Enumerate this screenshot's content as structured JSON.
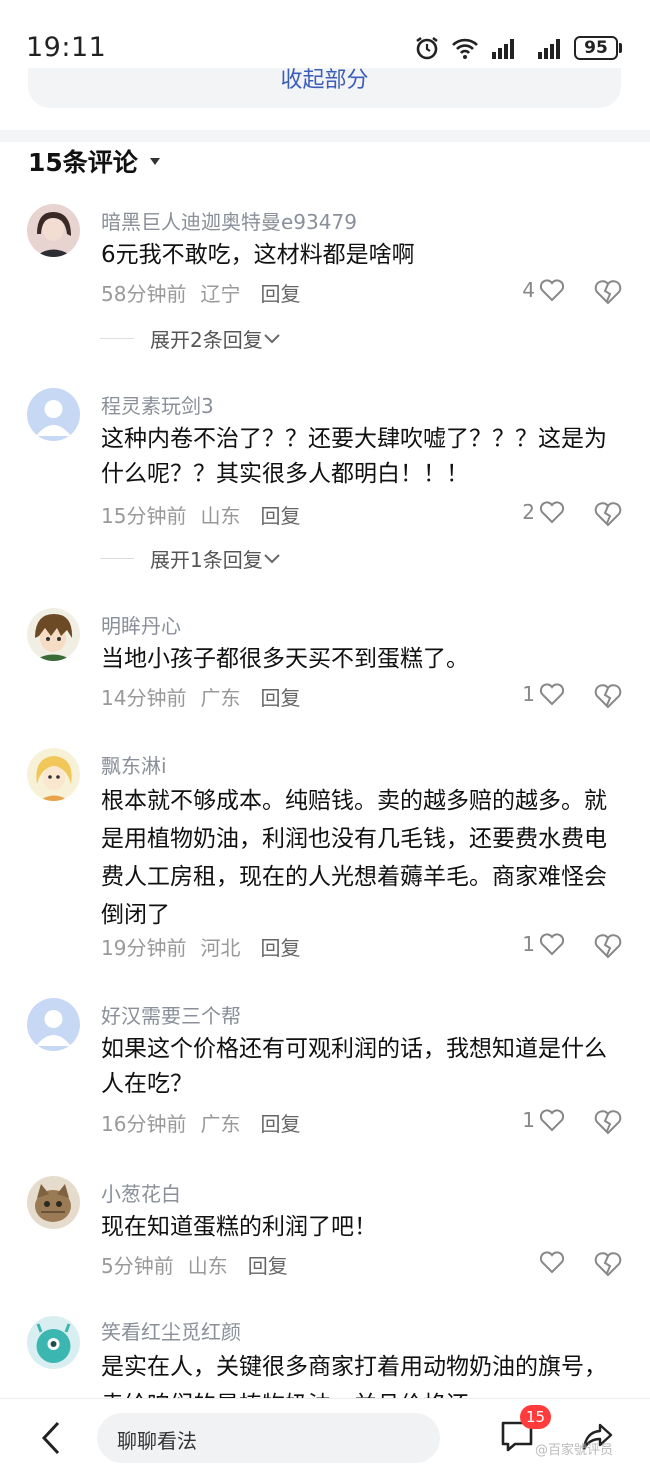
{
  "status_bar": {
    "time": "19:11",
    "battery": "95"
  },
  "top_card": {
    "text": "收起部分"
  },
  "comments_header": {
    "title": "15条评论"
  },
  "comments": [
    {
      "user": "暗黑巨人迪迦奥特曼e93479",
      "text": "6元我不敢吃，这材料都是啥啊",
      "time": "58分钟前",
      "location": "辽宁",
      "reply": "回复",
      "likes": "4",
      "expand": "展开2条回复"
    },
    {
      "user": "程灵素玩剑3",
      "text": "这种内卷不治了？？还要大肆吹嘘了？？？这是为什么呢？？其实很多人都明白！！！",
      "time": "15分钟前",
      "location": "山东",
      "reply": "回复",
      "likes": "2",
      "expand": "展开1条回复"
    },
    {
      "user": "明眸丹心",
      "text": "当地小孩子都很多天买不到蛋糕了。",
      "time": "14分钟前",
      "location": "广东",
      "reply": "回复",
      "likes": "1"
    },
    {
      "user": "飘东淋i",
      "text": "根本就不够成本。纯赔钱。卖的越多赔的越多。就是用植物奶油，利润也没有几毛钱，还要费水费电费人工房租，现在的人光想着薅羊毛。商家难怪会倒闭了",
      "time": "19分钟前",
      "location": "河北",
      "reply": "回复",
      "likes": "1"
    },
    {
      "user": "好汉需要三个帮",
      "text": "如果这个价格还有可观利润的话，我想知道是什么人在吃？",
      "time": "16分钟前",
      "location": "广东",
      "reply": "回复",
      "likes": "1"
    },
    {
      "user": "小葱花白",
      "text": "现在知道蛋糕的利润了吧！",
      "time": "5分钟前",
      "location": "山东",
      "reply": "回复",
      "likes": ""
    },
    {
      "user": "笑看红尘觅红颜",
      "text": "是实在人，关键很多商家打着用动物奶油的旗号，卖给咱们的是植物奶油，并且价格还",
      "time": "",
      "location": "",
      "reply": "",
      "likes": ""
    }
  ],
  "bottom_bar": {
    "input_placeholder": "聊聊看法",
    "comment_badge": "15",
    "watermark": "@百家號评员"
  },
  "colors": {
    "link_blue": "#3c5db8",
    "badge_red": "#ff3b3b"
  }
}
